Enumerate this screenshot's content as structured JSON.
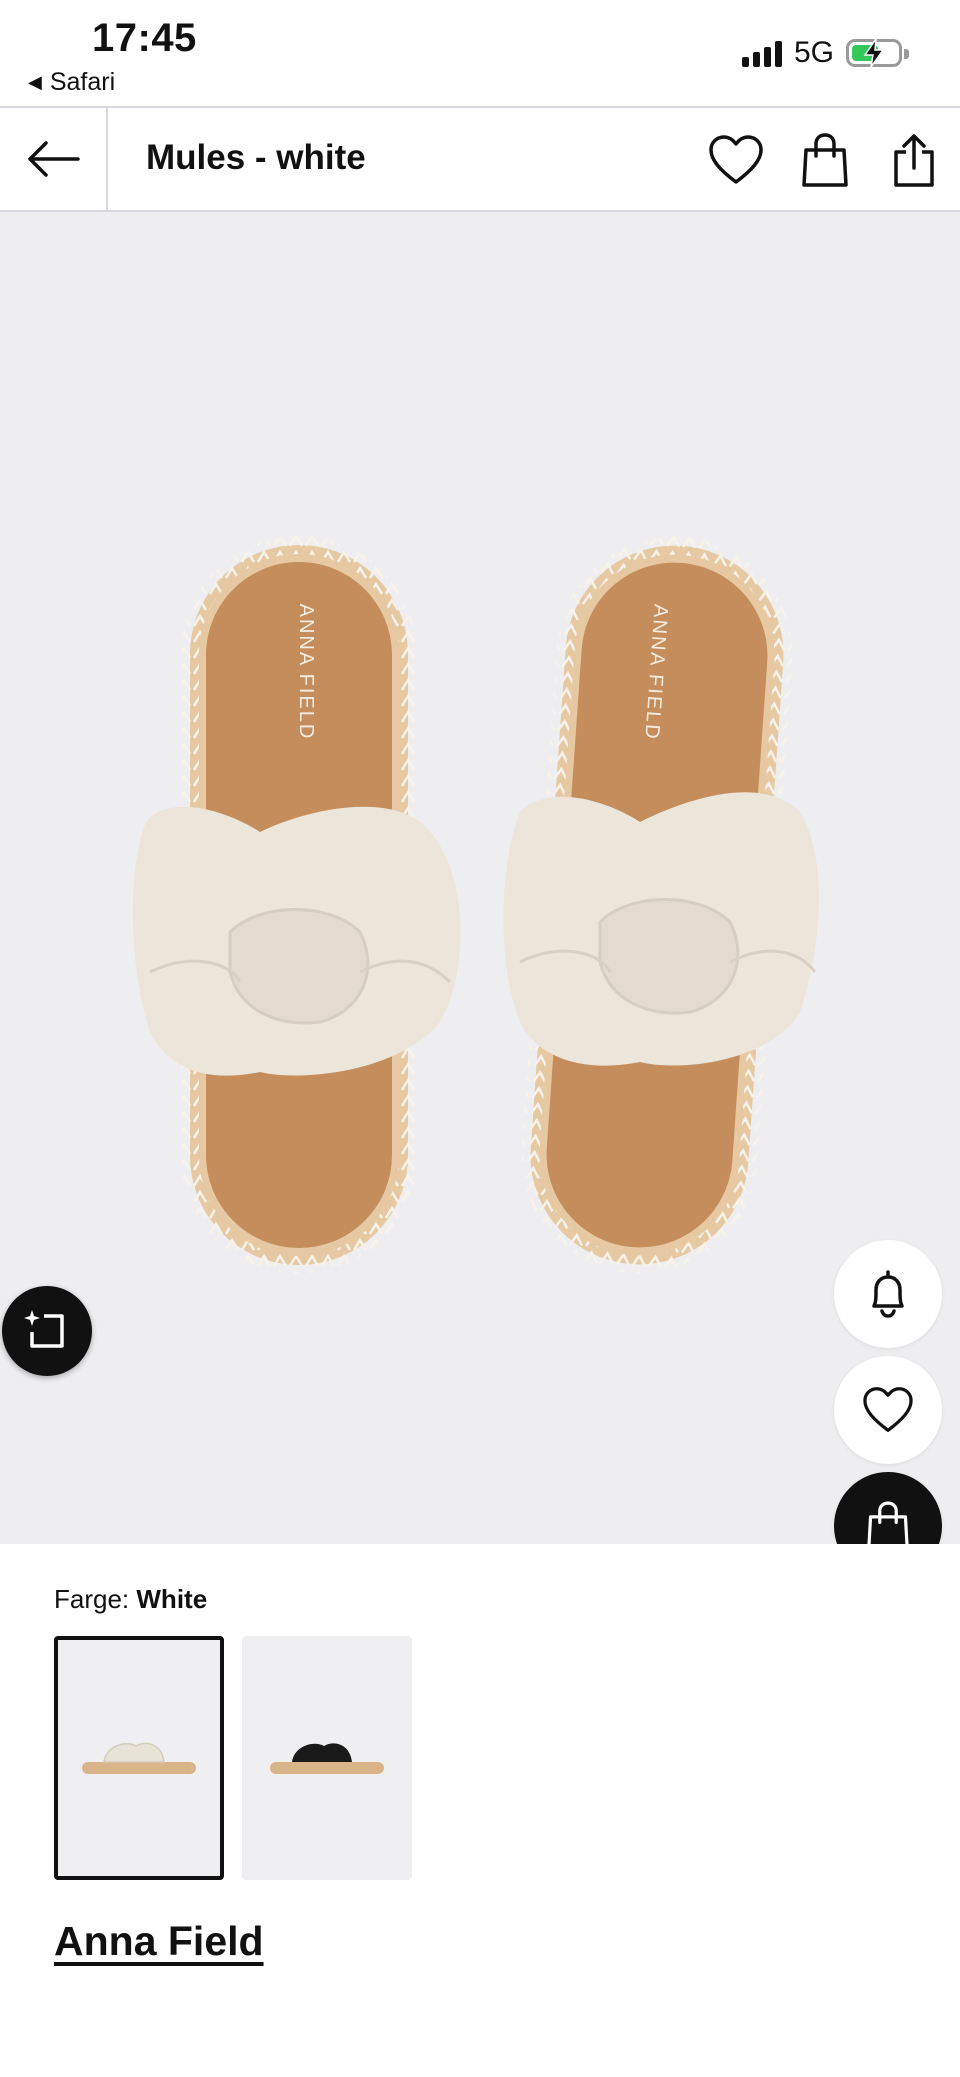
{
  "status_bar": {
    "time": "17:45",
    "back_app": "Safari",
    "network": "5G"
  },
  "nav": {
    "title": "Mules - white"
  },
  "product": {
    "image_brand_print_left": "ANNA FIELD",
    "image_brand_print_right": "ANNA FIELD"
  },
  "color": {
    "label": "Farge:",
    "selected_value": "White",
    "swatches": [
      "white",
      "black"
    ]
  },
  "brand": {
    "name": "Anna Field"
  },
  "colors": {
    "sandal_strap": "#ebe5da",
    "sandal_sole": "#c48d5b",
    "sandal_rim": "#e6c9a3",
    "background": "#eeeef0"
  }
}
